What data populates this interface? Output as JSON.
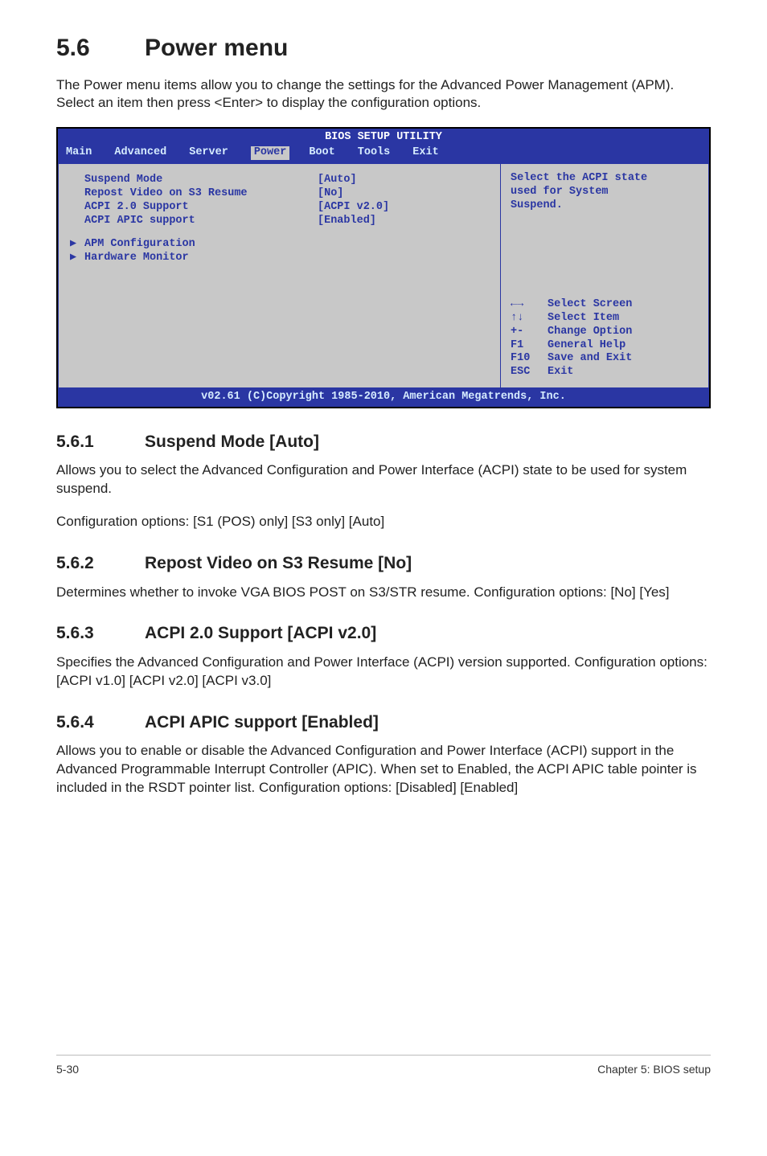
{
  "section": {
    "num": "5.6",
    "title": "Power menu"
  },
  "intro": "The Power menu items allow you to change the settings for the Advanced Power Management (APM). Select an item then press <Enter> to display the configuration options.",
  "bios": {
    "title": "BIOS SETUP UTILITY",
    "tabs": [
      "Main",
      "Advanced",
      "Server",
      "Power",
      "Boot",
      "Tools",
      "Exit"
    ],
    "active_tab": "Power",
    "rows": [
      {
        "label": "Suspend Mode",
        "value": "[Auto]"
      },
      {
        "label": "Repost Video on S3 Resume",
        "value": "[No]"
      },
      {
        "label": "ACPI 2.0 Support",
        "value": "[ACPI v2.0]"
      },
      {
        "label": "ACPI APIC support",
        "value": "[Enabled]"
      }
    ],
    "submenus": [
      "APM Configuration",
      "Hardware Monitor"
    ],
    "help": {
      "line1": "Select the ACPI state",
      "line2": "used for System",
      "line3": "Suspend."
    },
    "nav": [
      {
        "key": "←→",
        "action": "Select Screen"
      },
      {
        "key": "↑↓",
        "action": "Select Item"
      },
      {
        "key": "+-",
        "action": "Change Option"
      },
      {
        "key": "F1",
        "action": "General Help"
      },
      {
        "key": "F10",
        "action": "Save and Exit"
      },
      {
        "key": "ESC",
        "action": "Exit"
      }
    ],
    "footer": "v02.61 (C)Copyright 1985-2010, American Megatrends, Inc."
  },
  "subs": {
    "s1": {
      "num": "5.6.1",
      "title": "Suspend Mode [Auto]",
      "p1": "Allows you to select the Advanced Configuration and Power Interface (ACPI) state to be used for system suspend.",
      "p2": "Configuration options: [S1 (POS) only] [S3 only] [Auto]"
    },
    "s2": {
      "num": "5.6.2",
      "title": "Repost Video on S3 Resume [No]",
      "p1": "Determines whether to invoke VGA BIOS POST on S3/STR resume. Configuration options: [No] [Yes]"
    },
    "s3": {
      "num": "5.6.3",
      "title": "ACPI 2.0 Support [ACPI v2.0]",
      "p1": "Specifies the Advanced Configuration and Power Interface (ACPI) version supported. Configuration options: [ACPI v1.0] [ACPI v2.0] [ACPI v3.0]"
    },
    "s4": {
      "num": "5.6.4",
      "title": "ACPI APIC support [Enabled]",
      "p1": "Allows you to enable or disable the Advanced Configuration and Power Interface (ACPI) support in the Advanced Programmable Interrupt Controller (APIC). When set to Enabled, the ACPI APIC table pointer is included in the RSDT pointer list. Configuration options: [Disabled] [Enabled]"
    }
  },
  "footer": {
    "left": "5-30",
    "right": "Chapter 5: BIOS setup"
  }
}
